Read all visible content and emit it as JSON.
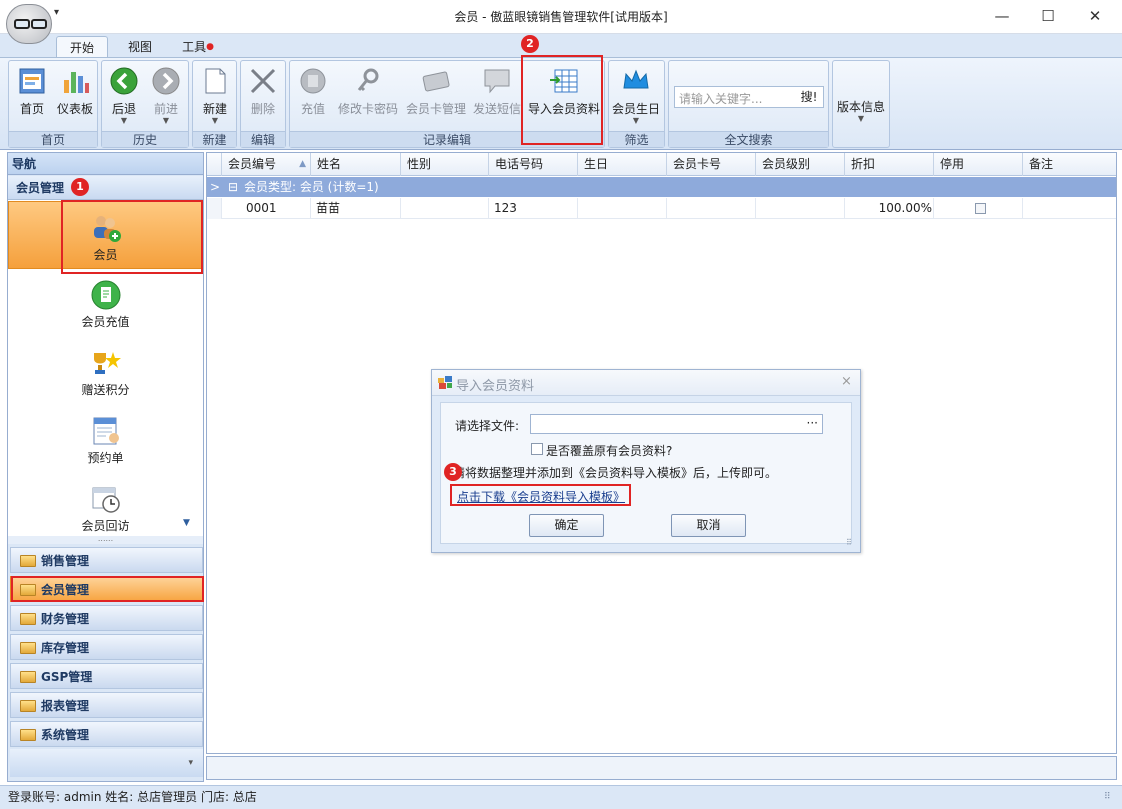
{
  "window": {
    "title": "会员 - 傲蓝眼镜销售管理软件[试用版本]",
    "qat_arrow": "▾",
    "min": "—",
    "max": "☐",
    "close": "✕"
  },
  "tabs": [
    "开始",
    "视图",
    "工具"
  ],
  "ribbon": {
    "buttons": {
      "home": "首页",
      "dashboard": "仪表板",
      "back": "后退",
      "forward": "前进",
      "new": "新建",
      "delete": "删除",
      "recharge": "充值",
      "change_pwd": "修改卡密码",
      "card_mgmt": "会员卡管理",
      "sms": "发送短信",
      "import": "导入会员资料",
      "birthday": "会员生日",
      "version": "版本信息"
    },
    "groups": {
      "home": "首页",
      "history": "历史",
      "new": "新建",
      "edit": "编辑",
      "record_edit": "记录编辑",
      "filter": "筛选",
      "fulltext": "全文搜索"
    },
    "search_placeholder": "请输入关键字...",
    "search_button": "搜!"
  },
  "nav": {
    "title": "导航",
    "current_group": "会员管理",
    "items": [
      "会员",
      "会员充值",
      "赠送积分",
      "预约单",
      "会员回访"
    ],
    "sections": [
      "销售管理",
      "会员管理",
      "财务管理",
      "库存管理",
      "GSP管理",
      "报表管理",
      "系统管理"
    ],
    "splitter": "......",
    "foot_arrow": "▾",
    "scroll_arrow": "▼"
  },
  "grid": {
    "columns": [
      "会员编号",
      "姓名",
      "性别",
      "电话号码",
      "生日",
      "会员卡号",
      "会员级别",
      "折扣",
      "停用",
      "备注"
    ],
    "sort_arrow": "▲",
    "group_label": "会员类型: 会员 (计数=1)",
    "group_expander": "⊟",
    "row_marker": ">",
    "rows": [
      {
        "id": "0001",
        "name": "苗苗",
        "gender": "",
        "phone": "123",
        "birthday": "",
        "card": "",
        "level": "",
        "discount": "100.00%",
        "disabled": false,
        "note": ""
      }
    ]
  },
  "status": "登录账号: admin  姓名: 总店管理员  门店: 总店",
  "dialog": {
    "title": "导入会员资料",
    "close": "×",
    "file_label": "请选择文件:",
    "browse": "···",
    "overwrite_label": "是否覆盖原有会员资料?",
    "hint": "请将数据整理并添加到《会员资料导入模板》后，上传即可。",
    "download_link": "点击下载《会员资料导入模板》",
    "ok": "确定",
    "cancel": "取消"
  },
  "badges": [
    "1",
    "2",
    "3"
  ],
  "colors": {
    "accent_red": "#e02424",
    "nav_active": "#f5a03c",
    "group_row": "#8eaadb"
  }
}
